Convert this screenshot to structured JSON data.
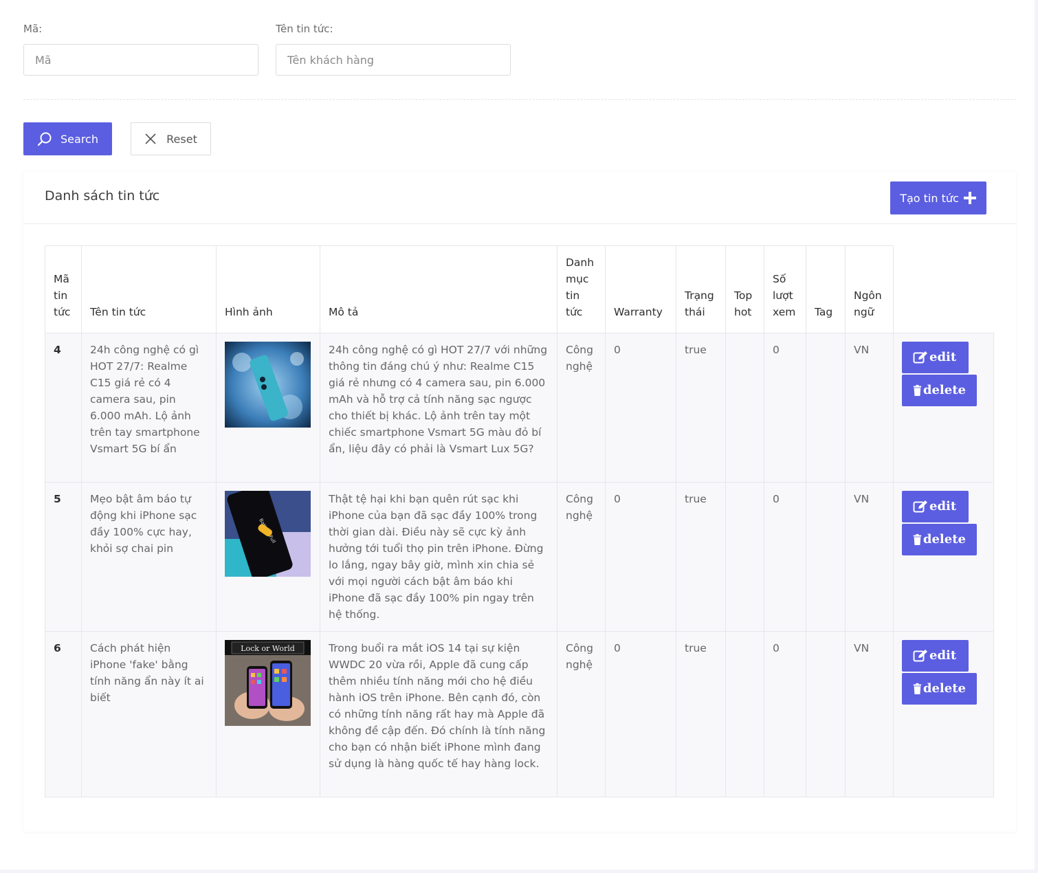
{
  "filters": {
    "code_label": "Mã:",
    "code_placeholder": "Mã",
    "name_label": "Tên tin tức:",
    "name_placeholder": "Tên khách hàng"
  },
  "actions": {
    "search_label": "Search",
    "reset_label": "Reset"
  },
  "card": {
    "title": "Danh sách tin tức",
    "create_label": "Tạo tin tức"
  },
  "table": {
    "headers": [
      "Mã tin tức",
      "Tên tin tức",
      "Hình ảnh",
      "Mô tả",
      "Danh mục tin tức",
      "Warranty",
      "Trạng thái",
      "Top hot",
      "Số lượt xem",
      "Tag",
      "Ngôn ngữ"
    ],
    "rows": [
      {
        "id": "4",
        "title": "24h công nghệ có gì HOT 27/7: Realme C15 giá rẻ có 4 camera sau, pin 6.000 mAh. Lộ ảnh trên tay smartphone Vsmart 5G bí ẩn",
        "description": "24h công nghệ có gì HOT 27/7 với những thông tin đáng chú ý như: Realme C15 giá rẻ nhưng có 4 camera sau, pin 6.000 mAh và hỗ trợ cả tính năng sạc ngược cho thiết bị khác. Lộ ảnh trên tay một chiếc smartphone Vsmart 5G màu đỏ bí ẩn, liệu đây có phải là Vsmart Lux 5G?",
        "category": "Công nghệ",
        "warranty": "0",
        "status": "true",
        "top_hot": "",
        "views": "0",
        "tag": "",
        "language": "VN",
        "image_text": ""
      },
      {
        "id": "5",
        "title": "Mẹo bật âm báo tự động khi iPhone sạc đầy 100% cực hay, khỏi sợ chai pin",
        "description": "Thật tệ hại khi bạn quên rút sạc khi iPhone của bạn đã sạc đầy 100% trong thời gian dài. Điều này sẽ cực kỳ ảnh hưởng tới tuổi thọ pin trên iPhone. Đừng lo lắng, ngay bây giờ, mình xin chia sẻ với mọi người cách bật âm báo khi iPhone đã sạc đầy 100% pin ngay trên hệ thống.",
        "category": "Công nghệ",
        "warranty": "0",
        "status": "true",
        "top_hot": "",
        "views": "0",
        "tag": "",
        "language": "VN",
        "image_text": "Battery Full"
      },
      {
        "id": "6",
        "title": "Cách phát hiện iPhone 'fake' bằng tính năng ẩn này ít ai biết",
        "description": "Trong buổi ra mắt iOS 14 tại sự kiện WWDC 20 vừa rồi, Apple đã cung cấp thêm nhiều tính năng mới cho hệ điều hành iOS trên iPhone. Bên cạnh đó, còn có những tính năng rất hay mà Apple đã không đề cập đến. Đó chính là tính năng cho bạn có nhận biết iPhone mình đang sử dụng là hàng quốc tế hay hàng lock.",
        "category": "Công nghệ",
        "warranty": "0",
        "status": "true",
        "top_hot": "",
        "views": "0",
        "tag": "",
        "language": "VN",
        "image_text": "Lock or World"
      }
    ],
    "edit_label": "edit",
    "delete_label": "delete"
  },
  "colors": {
    "accent": "#5b5ee0",
    "border": "#e6e6ec",
    "row_bg": "#f8f8fb"
  },
  "icons": {
    "search": "search-icon",
    "reset": "close-icon",
    "create": "plus-icon",
    "edit": "edit-icon",
    "delete": "trash-icon"
  }
}
